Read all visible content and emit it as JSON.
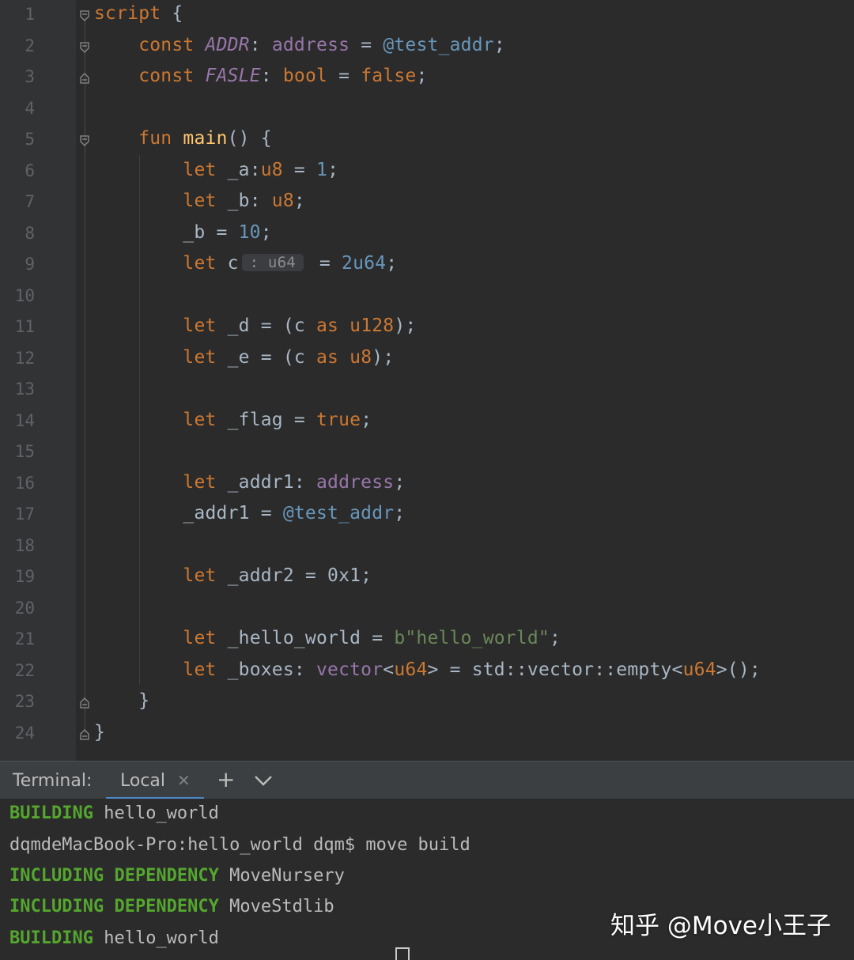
{
  "editor": {
    "lines": [
      {
        "num": "1"
      },
      {
        "num": "2"
      },
      {
        "num": "3"
      },
      {
        "num": "4"
      },
      {
        "num": "5"
      },
      {
        "num": "6"
      },
      {
        "num": "7"
      },
      {
        "num": "8"
      },
      {
        "num": "9"
      },
      {
        "num": "10"
      },
      {
        "num": "11"
      },
      {
        "num": "12"
      },
      {
        "num": "13"
      },
      {
        "num": "14"
      },
      {
        "num": "15"
      },
      {
        "num": "16"
      },
      {
        "num": "17"
      },
      {
        "num": "18"
      },
      {
        "num": "19"
      },
      {
        "num": "20"
      },
      {
        "num": "21"
      },
      {
        "num": "22"
      },
      {
        "num": "23"
      },
      {
        "num": "24"
      }
    ],
    "inlay_hint": ": u64",
    "colors": {
      "keyword": "#cc7832",
      "number": "#6897bb",
      "type": "#9876aa",
      "function": "#ffc66d",
      "string": "#6a8759",
      "text": "#a9b7c6",
      "background": "#2b2b2b"
    }
  },
  "terminal": {
    "title": "Terminal:",
    "tab_label": "Local",
    "close_icon": "close-icon",
    "add_icon": "plus-icon",
    "menu_icon": "chevron-down-icon",
    "output": [
      {
        "tag": "BUILDING",
        "text": " hello_world"
      },
      {
        "tag": "",
        "text": "dqmdeMacBook-Pro:hello_world dqm$ move build"
      },
      {
        "tag": "INCLUDING DEPENDENCY",
        "text": " MoveNursery"
      },
      {
        "tag": "INCLUDING DEPENDENCY",
        "text": " MoveStdlib"
      },
      {
        "tag": "BUILDING",
        "text": " hello_world"
      }
    ],
    "accent": "#54a62e"
  },
  "watermark": "知乎 @Move小王子"
}
